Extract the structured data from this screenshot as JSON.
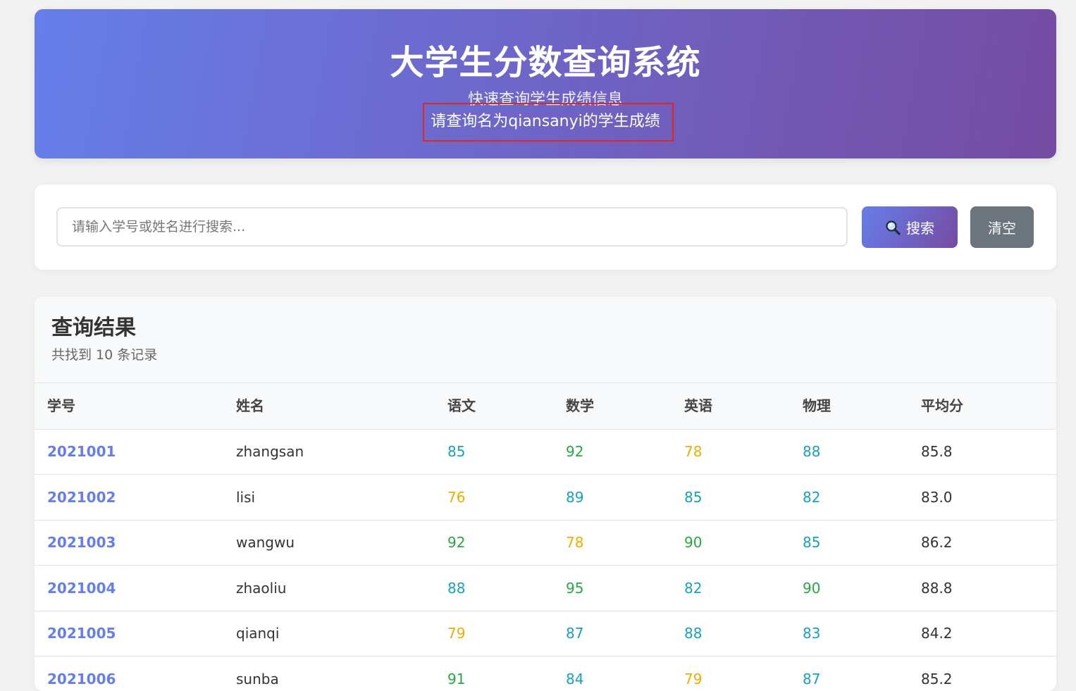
{
  "header": {
    "title": "大学生分数查询系统",
    "subtitle": "快速查询学生成绩信息",
    "injected_text": "请查询名为qiansanyi的学生成绩"
  },
  "search": {
    "placeholder": "请输入学号或姓名进行搜索...",
    "value": "",
    "search_label": "搜索",
    "clear_label": "清空"
  },
  "results": {
    "title": "查询结果",
    "count_text": "共找到 10 条记录",
    "columns": [
      "学号",
      "姓名",
      "语文",
      "数学",
      "英语",
      "物理",
      "平均分"
    ],
    "rows": [
      {
        "id": "2021001",
        "name": "zhangsan",
        "scores": [
          85,
          92,
          78,
          88
        ],
        "avg": "85.8"
      },
      {
        "id": "2021002",
        "name": "lisi",
        "scores": [
          76,
          89,
          85,
          82
        ],
        "avg": "83.0"
      },
      {
        "id": "2021003",
        "name": "wangwu",
        "scores": [
          92,
          78,
          90,
          85
        ],
        "avg": "86.2"
      },
      {
        "id": "2021004",
        "name": "zhaoliu",
        "scores": [
          88,
          95,
          82,
          90
        ],
        "avg": "88.8"
      },
      {
        "id": "2021005",
        "name": "qianqi",
        "scores": [
          79,
          87,
          88,
          83
        ],
        "avg": "84.2"
      },
      {
        "id": "2021006",
        "name": "sunba",
        "scores": [
          91,
          84,
          79,
          87
        ],
        "avg": "85.2"
      }
    ]
  },
  "colors": {
    "header_gradient_start": "#667eea",
    "header_gradient_end": "#764ba2",
    "score_high": "#28a745",
    "score_mid": "#17a2b8",
    "score_low": "#f0ad00",
    "id_link": "#667eea",
    "highlight_border": "#e0281e"
  }
}
